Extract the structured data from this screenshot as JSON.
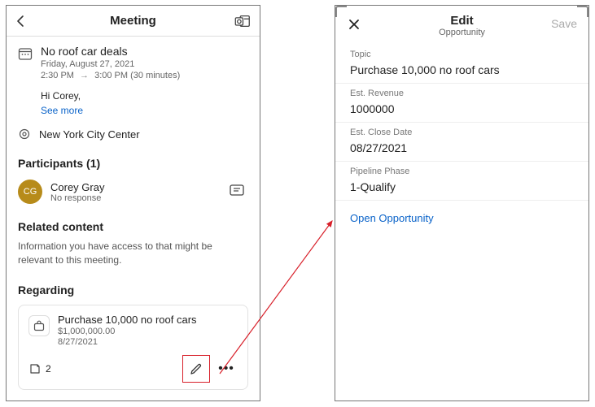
{
  "left": {
    "header": {
      "title": "Meeting"
    },
    "meeting": {
      "title": "No roof car deals",
      "date": "Friday, August 27, 2021",
      "time_start": "2:30 PM",
      "time_end": "3:00 PM",
      "duration": "(30 minutes)",
      "greeting": "Hi Corey,",
      "see_more": "See more",
      "location": "New York City Center"
    },
    "participants": {
      "heading": "Participants (1)",
      "items": [
        {
          "initials": "CG",
          "name": "Corey Gray",
          "response": "No response"
        }
      ]
    },
    "related": {
      "heading": "Related content",
      "desc": "Information you have access to that might be relevant to this meeting."
    },
    "regarding": {
      "heading": "Regarding",
      "card": {
        "title": "Purchase 10,000 no roof cars",
        "amount": "$1,000,000.00",
        "date": "8/27/2021",
        "notes_count": "2"
      }
    }
  },
  "right": {
    "header": {
      "title": "Edit",
      "subtitle": "Opportunity",
      "save": "Save"
    },
    "fields": {
      "topic": {
        "label": "Topic",
        "value": "Purchase 10,000 no roof cars"
      },
      "revenue": {
        "label": "Est. Revenue",
        "value": "1000000"
      },
      "close_date": {
        "label": "Est. Close Date",
        "value": "08/27/2021"
      },
      "phase": {
        "label": "Pipeline Phase",
        "value": "1-Qualify"
      }
    },
    "open_link": "Open Opportunity"
  }
}
